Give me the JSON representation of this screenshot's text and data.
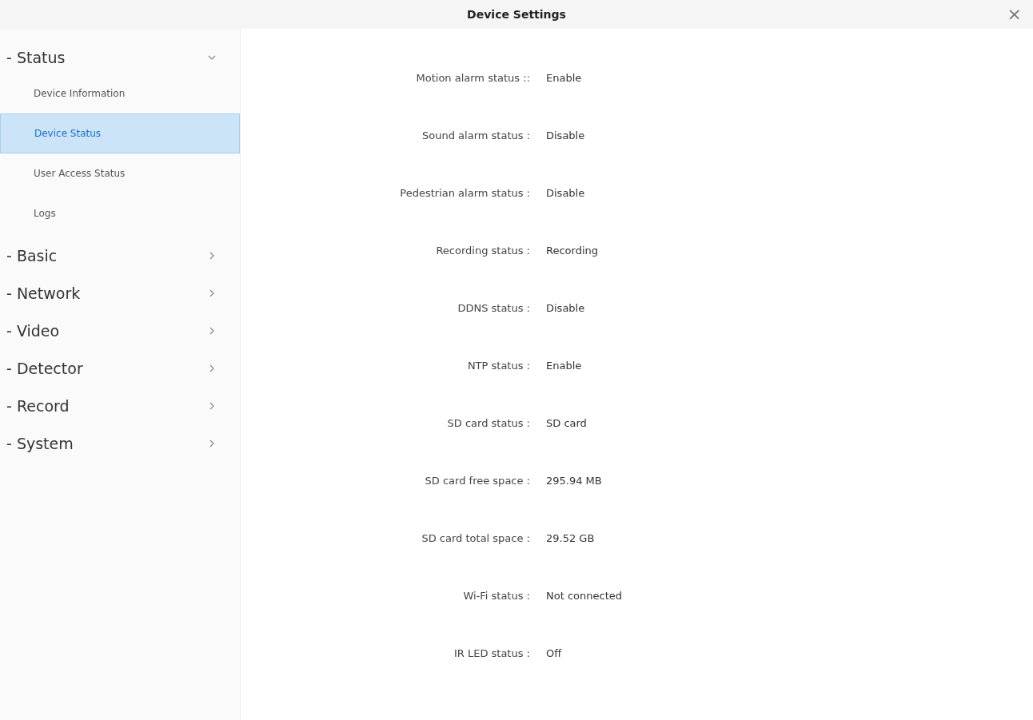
{
  "window": {
    "title": "Device Settings",
    "close": "×"
  },
  "sidebar": {
    "groups": [
      {
        "label": "- Status",
        "expanded": true,
        "children": [
          {
            "label": "Device Information",
            "selected": false
          },
          {
            "label": "Device Status",
            "selected": true
          },
          {
            "label": "User Access Status",
            "selected": false
          },
          {
            "label": "Logs",
            "selected": false
          }
        ]
      },
      {
        "label": "- Basic",
        "expanded": false
      },
      {
        "label": "- Network",
        "expanded": false
      },
      {
        "label": "- Video",
        "expanded": false
      },
      {
        "label": "- Detector",
        "expanded": false
      },
      {
        "label": "- Record",
        "expanded": false
      },
      {
        "label": "- System",
        "expanded": false
      }
    ]
  },
  "status_rows": [
    {
      "label": "Motion alarm status ::",
      "value": "Enable"
    },
    {
      "label": "Sound alarm status :",
      "value": "Disable"
    },
    {
      "label": "Pedestrian alarm status :",
      "value": "Disable"
    },
    {
      "label": "Recording status :",
      "value": "Recording"
    },
    {
      "label": "DDNS status :",
      "value": "Disable"
    },
    {
      "label": "NTP status :",
      "value": "Enable"
    },
    {
      "label": "SD card status :",
      "value": "SD card"
    },
    {
      "label": "SD card free space :",
      "value": "295.94 MB"
    },
    {
      "label": "SD card total space :",
      "value": "29.52 GB"
    },
    {
      "label": "Wi-Fi status :",
      "value": "Not connected"
    },
    {
      "label": "IR LED status :",
      "value": "Off"
    }
  ]
}
